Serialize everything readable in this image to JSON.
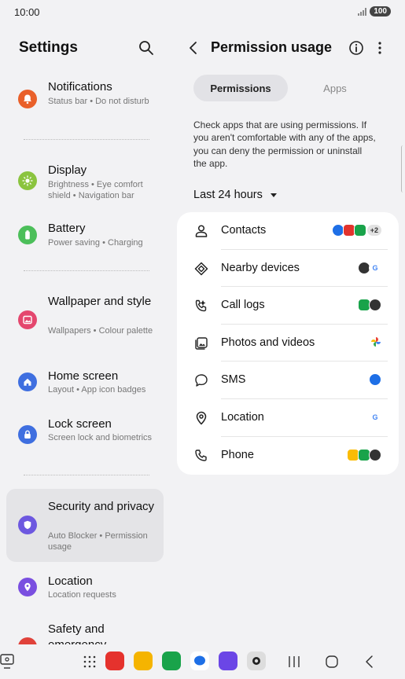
{
  "status_bar": {
    "time": "10:00",
    "battery": "100"
  },
  "left_panel": {
    "title": "Settings",
    "items": [
      {
        "id": "notifications",
        "title": "Notifications",
        "subtitle": "Status bar • Do not disturb",
        "color": "#e9602a"
      },
      {
        "id": "display",
        "title": "Display",
        "subtitle": "Brightness • Eye comfort shield • Navigation bar",
        "color": "#8bc43f"
      },
      {
        "id": "battery",
        "title": "Battery",
        "subtitle": "Power saving • Charging",
        "color": "#4cbf5a"
      },
      {
        "id": "wallpaper",
        "title": "Wallpaper and style",
        "subtitle": "Wallpapers • Colour palette",
        "color": "#e4476e"
      },
      {
        "id": "home",
        "title": "Home screen",
        "subtitle": "Layout • App icon badges",
        "color": "#3f6fe0"
      },
      {
        "id": "lock",
        "title": "Lock screen",
        "subtitle": "Screen lock and biometrics",
        "color": "#3f6fe0"
      },
      {
        "id": "security",
        "title": "Security and privacy",
        "subtitle": "Auto Blocker • Permission usage",
        "color": "#6d58e0"
      },
      {
        "id": "location",
        "title": "Location",
        "subtitle": "Location requests",
        "color": "#7a4fe0"
      },
      {
        "id": "safety",
        "title": "Safety and emergency",
        "subtitle": "",
        "color": "#e0423a"
      }
    ]
  },
  "right_panel": {
    "title": "Permission usage",
    "tabs": [
      {
        "label": "Permissions",
        "active": true
      },
      {
        "label": "Apps",
        "active": false
      }
    ],
    "description": "Check apps that are using permissions. If you aren't comfortable with any of the apps, you can deny the permission or uninstall the app.",
    "filter": "Last 24 hours",
    "permissions": [
      {
        "label": "Contacts",
        "icon": "person-icon",
        "extra": "+2"
      },
      {
        "label": "Nearby devices",
        "icon": "nearby-devices-icon"
      },
      {
        "label": "Call logs",
        "icon": "call-log-icon"
      },
      {
        "label": "Photos and videos",
        "icon": "photo-icon"
      },
      {
        "label": "SMS",
        "icon": "message-bubble-icon"
      },
      {
        "label": "Location",
        "icon": "location-pin-icon"
      },
      {
        "label": "Phone",
        "icon": "phone-icon"
      }
    ]
  }
}
